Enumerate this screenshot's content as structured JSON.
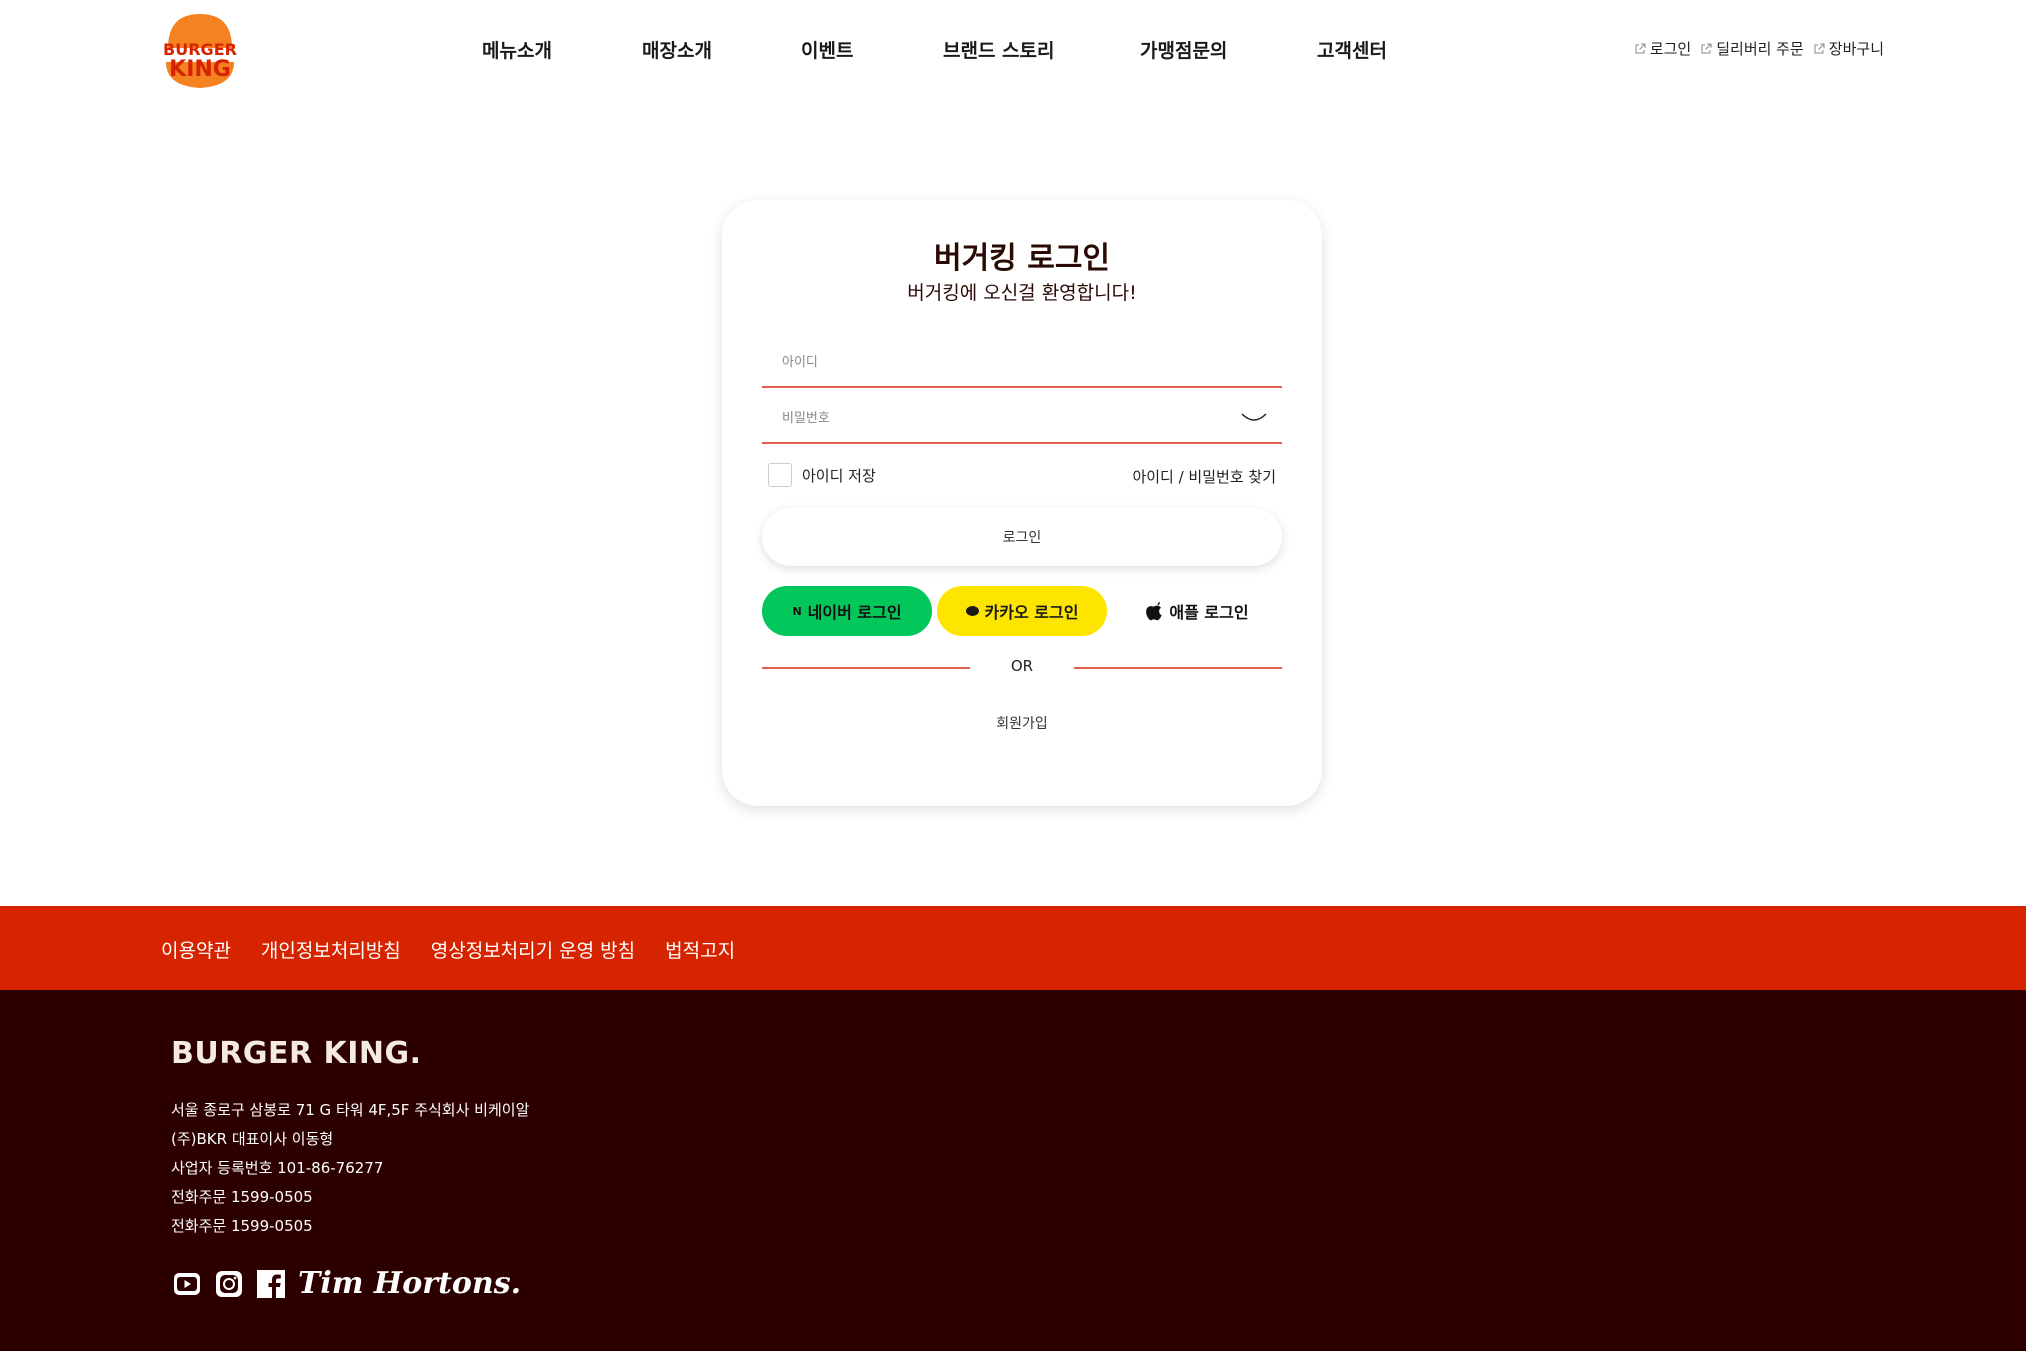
{
  "header": {
    "brand_top": "BURGER",
    "brand_bottom": "KING",
    "nav": [
      "메뉴소개",
      "매장소개",
      "이벤트",
      "브랜드 스토리",
      "가맹점문의",
      "고객센터"
    ],
    "util": [
      "로그인",
      "딜리버리 주문",
      "장바구니"
    ]
  },
  "login": {
    "title": "버거킹 로그인",
    "subtitle": "버거킹에 오신걸 환영합니다!",
    "id_placeholder": "아이디",
    "pw_placeholder": "비밀번호",
    "save_id": "아이디 저장",
    "find": "아이디 / 비밀번호 찾기",
    "login_button": "로그인",
    "naver_icon": "N",
    "naver": "네이버 로그인",
    "kakao": "카카오 로그인",
    "apple": "애플 로그인",
    "or": "OR",
    "signup": "회원가입"
  },
  "footer": {
    "links": [
      "이용약관",
      "개인정보처리방침",
      "영상정보처리기 운영 방침",
      "법적고지"
    ],
    "logo": "BURGER KING.",
    "info": [
      "서울 종로구 삼봉로 71 G 타워 4F,5F 주식회사 비케이알",
      "(주)BKR 대표이사 이동형",
      "사업자 등록번호 101-86-76277",
      "전화주문 1599-0505",
      "전화주문 1599-0505"
    ],
    "tim_hortons": "Tim Hortons."
  },
  "colors": {
    "brand_red": "#d62300",
    "footer_brown": "#2d0000",
    "naver_green": "#03c75a",
    "kakao_yellow": "#fee500",
    "field_line": "#e2604b"
  }
}
